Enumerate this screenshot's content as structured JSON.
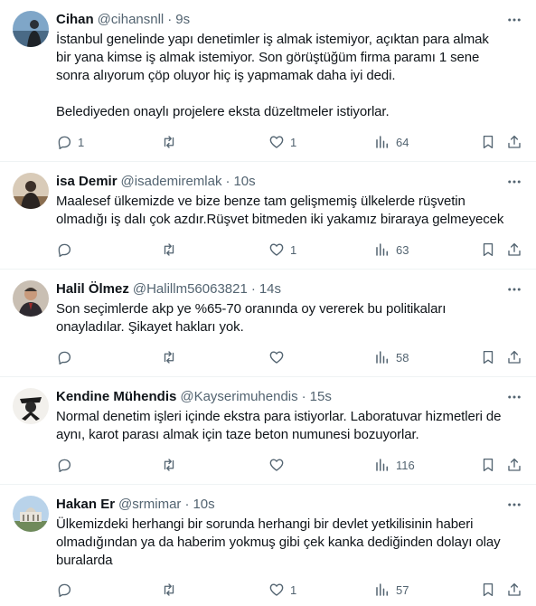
{
  "tweets": [
    {
      "name": "Cihan",
      "handle": "@cihansnll",
      "time": "9s",
      "text": "İstanbul genelinde yapı denetimler iş almak istemiyor, açıktan para almak\nbir yana kimse iş almak istemiyor. Son görüştüğüm firma paramı 1 sene\nsonra alıyorum çöp oluyor hiç iş yapmamak daha iyi dedi.\n\nBelediyeden onaylı projelere eksta düzeltmeler istiyorlar.",
      "replies": "1",
      "retweets": "",
      "likes": "1",
      "views": "64"
    },
    {
      "name": "isa Demir",
      "handle": "@isademiremlak",
      "time": "10s",
      "text": "Maalesef ülkemizde ve bize benze tam gelişmemiş ülkelerde rüşvetin\nolmadığı iş dalı çok azdır.Rüşvet bitmeden iki yakamız biraraya gelmeyecek",
      "replies": "",
      "retweets": "",
      "likes": "1",
      "views": "63"
    },
    {
      "name": "Halil Ölmez",
      "handle": "@Halillm56063821",
      "time": "14s",
      "text": "Son seçimlerde akp ye %65-70 oranında oy vererek bu politikaları\nonayladılar. Şikayet hakları yok.",
      "replies": "",
      "retweets": "",
      "likes": "",
      "views": "58"
    },
    {
      "name": "Kendine Mühendis",
      "handle": "@Kayserimuhendis",
      "time": "15s",
      "text": "Normal denetim işleri içinde ekstra para istiyorlar. Laboratuvar hizmetleri de\naynı, karot parası almak için taze beton numunesi bozuyorlar.",
      "replies": "",
      "retweets": "",
      "likes": "",
      "views": "116"
    },
    {
      "name": "Hakan Er",
      "handle": "@srmimar",
      "time": "10s",
      "text": "Ülkemizdeki herhangi bir sorunda herhangi bir devlet yetkilisinin haberi\nolmadığından ya da haberim yokmuş gibi çek kanka dediğinden dolayı olay\nburalarda",
      "replies": "",
      "retweets": "",
      "likes": "1",
      "views": "57"
    }
  ],
  "separator": "·",
  "icons": {
    "more": "more-dots-icon",
    "reply": "reply-bubble-icon",
    "retweet": "retweet-icon",
    "like": "heart-icon",
    "views": "views-chart-icon",
    "bookmark": "bookmark-icon",
    "share": "share-icon"
  },
  "colors": {
    "text": "#0f1419",
    "secondary": "#536471",
    "divider": "#eff3f4"
  }
}
